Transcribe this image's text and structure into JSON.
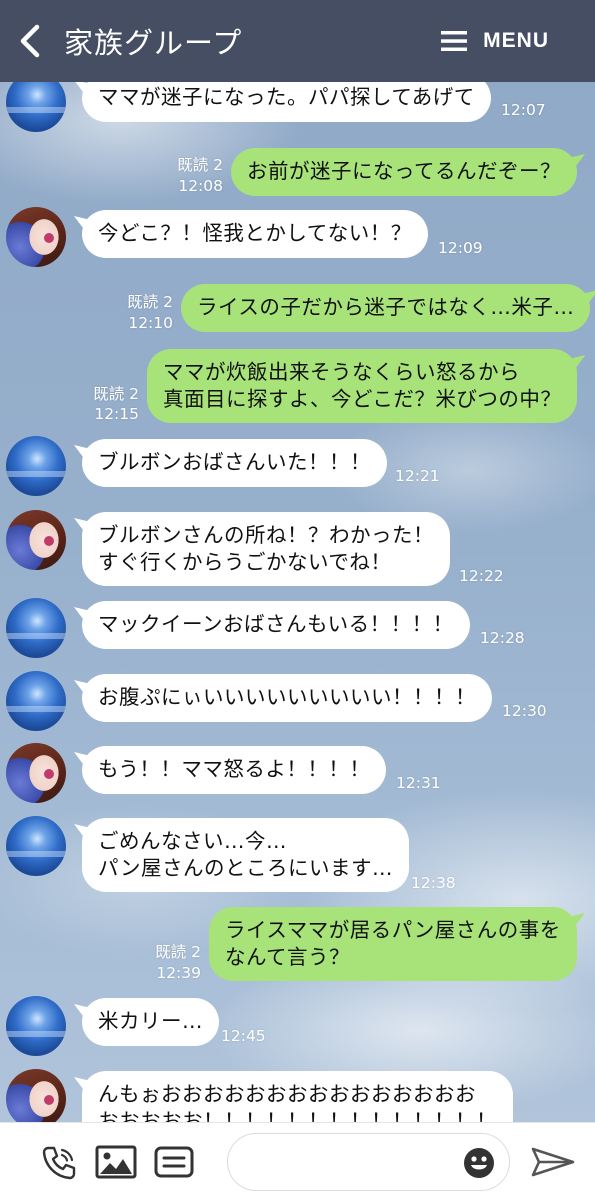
{
  "header": {
    "title": "家族グループ",
    "menu_label": "MENU"
  },
  "messages": [
    {
      "side": "left",
      "avatar": "ocean",
      "text": "ママが迷子になった。パパ探してあげて",
      "time": "12:07"
    },
    {
      "side": "right",
      "read": "既読 2",
      "text": "お前が迷子になってるんだぞー？",
      "time": "12:08"
    },
    {
      "side": "left",
      "avatar": "girl",
      "text": "今どこ？！怪我とかしてない！？",
      "time": "12:09"
    },
    {
      "side": "right",
      "read": "既読 2",
      "text": "ライスの子だから迷子ではなく…米子…",
      "time": "12:10"
    },
    {
      "side": "right",
      "read": "既読 2",
      "text": "ママが炊飯出来そうなくらい怒るから\n真面目に探すよ、今どこだ？米びつの中？",
      "time": "12:15"
    },
    {
      "side": "left",
      "avatar": "ocean",
      "text": "ブルボンおばさんいた！！！",
      "time": "12:21"
    },
    {
      "side": "left",
      "avatar": "girl",
      "text": "ブルボンさんの所ね！？わかった！\nすぐ行くからうごかないでね！",
      "time": "12:22"
    },
    {
      "side": "left",
      "avatar": "ocean",
      "text": "マックイーンおばさんもいる！！！！",
      "time": "12:28"
    },
    {
      "side": "left",
      "avatar": "ocean",
      "text": "お腹ぷにぃいいいいいいいいい！！！！",
      "time": "12:30"
    },
    {
      "side": "left",
      "avatar": "girl",
      "text": "もう！！ママ怒るよ！！！！",
      "time": "12:31"
    },
    {
      "side": "left",
      "avatar": "ocean",
      "text": "ごめんなさい…今…\nパン屋さんのところにいます…",
      "time": "12:38"
    },
    {
      "side": "right",
      "read": "既読 2",
      "text": "ライスママが居るパン屋さんの事を\nなんて言う？",
      "time": "12:39"
    },
    {
      "side": "left",
      "avatar": "ocean",
      "text": "米カリー…",
      "time": "12:45"
    },
    {
      "side": "left",
      "avatar": "girl",
      "text": "んもぉおおおおおおおおおおおおおおお\nおおおおお！！！！！！！！！！！！！！",
      "time": ""
    }
  ],
  "input": {
    "placeholder": ""
  },
  "icons": {
    "back": "chevron-left-icon",
    "menu": "hamburger-icon",
    "call": "phone-icon",
    "image": "image-icon",
    "sticker": "card-icon",
    "emoji": "smiley-icon",
    "send": "paper-plane-icon"
  },
  "colors": {
    "header_bg": "#464e63",
    "bubble_mine": "#a8e37a",
    "bubble_theirs": "#ffffff"
  }
}
